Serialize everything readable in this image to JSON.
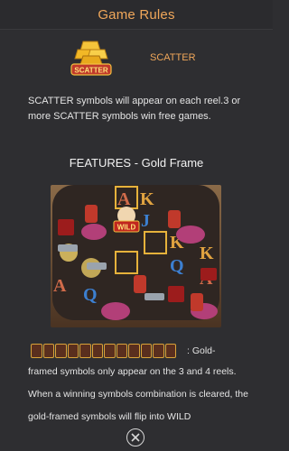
{
  "header": {
    "title": "Game Rules"
  },
  "scatter": {
    "icon": "scatter-gold-bars-icon",
    "icon_text": "SCATTER",
    "label": "SCATTER",
    "description": "SCATTER symbols will appear on each reel.3 or more SCATTER symbols win free games."
  },
  "features": {
    "title": "FEATURES - Gold Frame",
    "reel_badge": "WILD",
    "strip_text": ": Gold-",
    "body_text": "framed symbols only appear on the 3 and 4 reels. When a winning symbols combination is cleared, the gold-framed symbols will flip into WILD"
  },
  "footer": {
    "close_icon": "close-icon"
  },
  "colors": {
    "accent": "#f0a75a",
    "background": "#2e2e31",
    "gold": "#d9a339"
  }
}
